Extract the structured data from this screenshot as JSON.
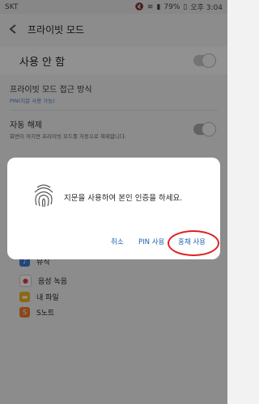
{
  "status": {
    "carrier": "SKT",
    "battery": "79%",
    "time": "오후 3:04"
  },
  "header": {
    "title": "프라이빗 모드"
  },
  "main": {
    "master_label": "사용 안 함",
    "access": {
      "title": "프라이빗 모드 접근 방식",
      "subtitle": "PIN(지문 사용 가능)"
    },
    "auto": {
      "title": "자동 해제",
      "subtitle": "화면이 꺼지면 프라이빗 모드를 자동으로 해제합니다."
    },
    "apps": [
      {
        "label": "뮤직",
        "color": "#3c7ad6"
      },
      {
        "label": "음성 녹음",
        "color": "#e23b3b"
      },
      {
        "label": "내 파일",
        "color": "#f3b21e"
      },
      {
        "label": "S노트",
        "color": "#f07c2e"
      }
    ]
  },
  "dialog": {
    "message": "지문을 사용하여 본인 인증을 하세요.",
    "buttons": {
      "cancel": "취소",
      "pin": "PIN 사용",
      "use": "홍채 사용"
    }
  },
  "colors": {
    "accent": "#1c63b0",
    "highlight": "#e02020"
  }
}
